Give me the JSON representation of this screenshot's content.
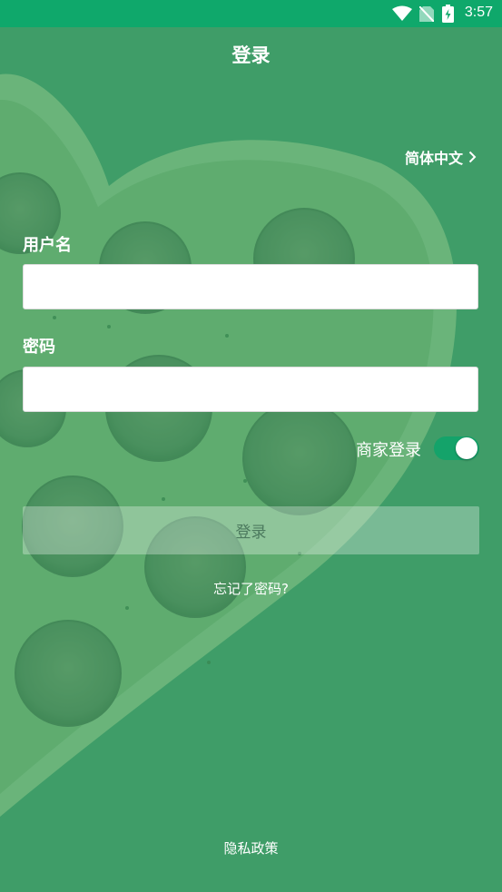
{
  "status_bar": {
    "time": "3:57",
    "icons": [
      "wifi-icon",
      "no-sim-icon",
      "battery-charging-icon"
    ],
    "bg_color": "#0fa86b"
  },
  "header": {
    "title": "登录"
  },
  "language": {
    "label": "简体中文",
    "icon": "chevron-right-icon"
  },
  "form": {
    "username_label": "用户名",
    "username_value": "",
    "password_label": "密码",
    "password_value": "",
    "merchant_login_label": "商家登录",
    "merchant_login_on": true,
    "login_button": "登录",
    "forgot_password": "忘记了密码?"
  },
  "footer": {
    "privacy": "隐私政策"
  },
  "colors": {
    "accent": "#14a36a",
    "background": "#4a9e6f"
  }
}
